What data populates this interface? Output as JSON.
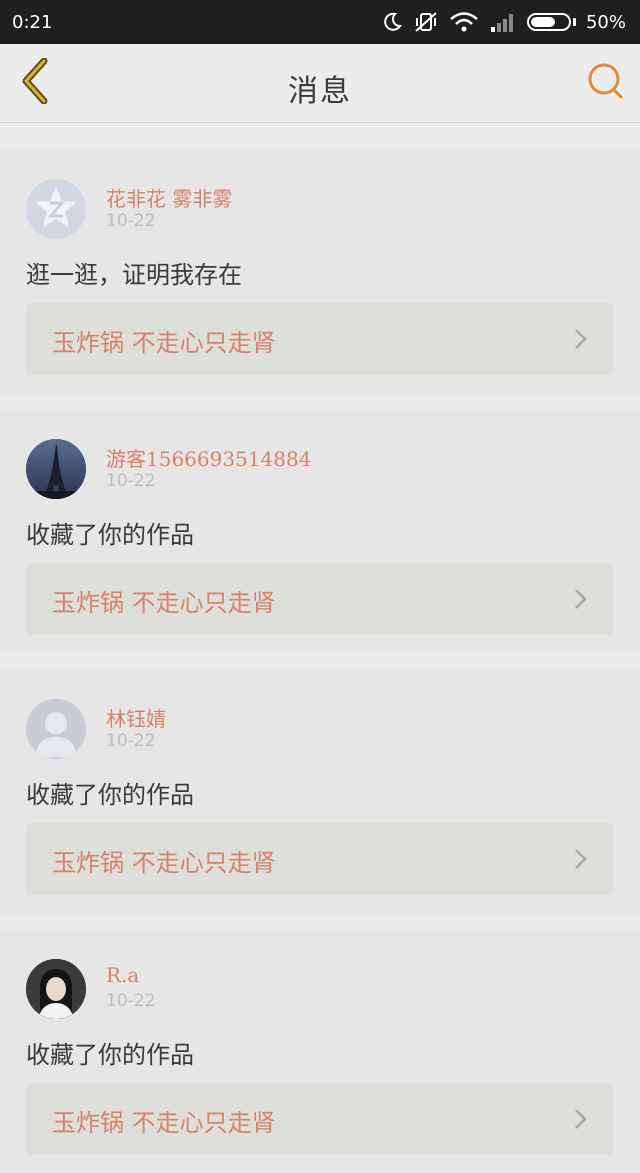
{
  "status_bar": {
    "time": "0:21",
    "battery_percent": "50%",
    "battery_level": 0.5,
    "icons": [
      "moon-icon",
      "mute-vibrate-icon",
      "wifi-icon",
      "signal-icon",
      "battery-icon"
    ]
  },
  "header": {
    "title": "消息",
    "back_icon": "chevron-left-icon",
    "search_icon": "search-icon",
    "accent_color": "#e08a3c"
  },
  "messages": [
    {
      "username": "花非花 雾非雾",
      "date": "10-22",
      "text": "逛一逛，证明我存在",
      "work_title": "玉炸锅 不走心只走肾",
      "avatar": "default-q-avatar"
    },
    {
      "username": "游客1566693514884",
      "date": "10-22",
      "text": "收藏了你的作品",
      "work_title": "玉炸锅 不走心只走肾",
      "avatar": "eiffel-tower-photo"
    },
    {
      "username": "林钰婧",
      "date": "10-22",
      "text": "收藏了你的作品",
      "work_title": "玉炸锅 不走心只走肾",
      "avatar": "default-person-avatar"
    },
    {
      "username": "R.a",
      "date": "10-22",
      "text": "收藏了你的作品",
      "work_title": "玉炸锅 不走心只走肾",
      "avatar": "girl-portrait-photo"
    }
  ]
}
